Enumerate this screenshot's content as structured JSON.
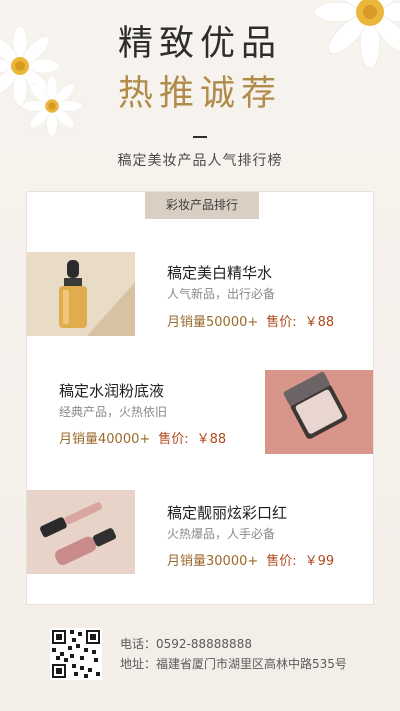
{
  "hero": {
    "title_line1": "精致优品",
    "title_line2": "热推诚荐",
    "subtitle": "稿定美妆产品人气排行榜"
  },
  "card": {
    "tag": "彩妆产品排行",
    "products": [
      {
        "name": "稿定美白精华水",
        "desc": "人气新品，出行必备",
        "sales": "月销量50000+",
        "price_label": "售价:",
        "price": "￥88",
        "image": "serum-dropper-bottle"
      },
      {
        "name": "稿定水润粉底液",
        "desc": "经典产品，火热依旧",
        "sales": "月销量40000+",
        "price_label": "售价:",
        "price": "￥88",
        "image": "compact-powder"
      },
      {
        "name": "稿定靓丽炫彩口红",
        "desc": "火热爆品，人手必备",
        "sales": "月销量30000+",
        "price_label": "售价:",
        "price": "￥99",
        "image": "lip-gloss-tubes"
      }
    ]
  },
  "footer": {
    "phone_label": "电话：",
    "phone": "0592-88888888",
    "address_label": "地址：",
    "address": "福建省厦门市湖里区高林中路535号"
  },
  "colors": {
    "gold": "#b08b4a",
    "price_red": "#b04a1e",
    "sales_brown": "#9a6a2b",
    "tag_bg": "#d9d0c3"
  }
}
